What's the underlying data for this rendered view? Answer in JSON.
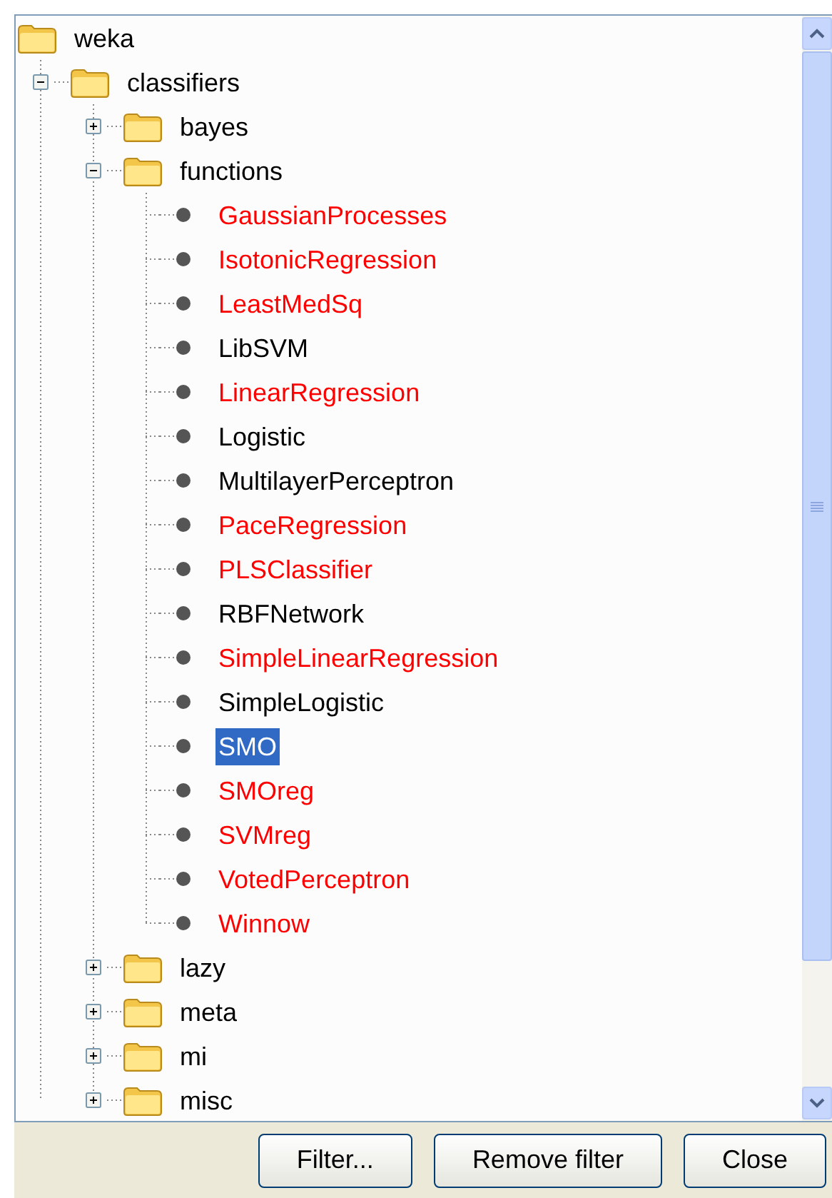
{
  "tree": {
    "label": "weka",
    "children": [
      {
        "kind": "folder",
        "label": "classifiers",
        "expanded": true,
        "children": [
          {
            "kind": "folder",
            "label": "bayes",
            "expanded": false
          },
          {
            "kind": "folder",
            "label": "functions",
            "expanded": true,
            "children": [
              {
                "kind": "leaf",
                "label": "GaussianProcesses",
                "color": "#ff0000",
                "selected": false
              },
              {
                "kind": "leaf",
                "label": "IsotonicRegression",
                "color": "#ff0000",
                "selected": false
              },
              {
                "kind": "leaf",
                "label": "LeastMedSq",
                "color": "#ff0000",
                "selected": false
              },
              {
                "kind": "leaf",
                "label": "LibSVM",
                "color": "#000000",
                "selected": false
              },
              {
                "kind": "leaf",
                "label": "LinearRegression",
                "color": "#ff0000",
                "selected": false
              },
              {
                "kind": "leaf",
                "label": "Logistic",
                "color": "#000000",
                "selected": false
              },
              {
                "kind": "leaf",
                "label": "MultilayerPerceptron",
                "color": "#000000",
                "selected": false
              },
              {
                "kind": "leaf",
                "label": "PaceRegression",
                "color": "#ff0000",
                "selected": false
              },
              {
                "kind": "leaf",
                "label": "PLSClassifier",
                "color": "#ff0000",
                "selected": false
              },
              {
                "kind": "leaf",
                "label": "RBFNetwork",
                "color": "#000000",
                "selected": false
              },
              {
                "kind": "leaf",
                "label": "SimpleLinearRegression",
                "color": "#ff0000",
                "selected": false
              },
              {
                "kind": "leaf",
                "label": "SimpleLogistic",
                "color": "#000000",
                "selected": false
              },
              {
                "kind": "leaf",
                "label": "SMO",
                "selected": true
              },
              {
                "kind": "leaf",
                "label": "SMOreg",
                "color": "#ff0000",
                "selected": false
              },
              {
                "kind": "leaf",
                "label": "SVMreg",
                "color": "#ff0000",
                "selected": false
              },
              {
                "kind": "leaf",
                "label": "VotedPerceptron",
                "color": "#ff0000",
                "selected": false
              },
              {
                "kind": "leaf",
                "label": "Winnow",
                "color": "#ff0000",
                "selected": false
              }
            ]
          },
          {
            "kind": "folder",
            "label": "lazy",
            "expanded": false
          },
          {
            "kind": "folder",
            "label": "meta",
            "expanded": false
          },
          {
            "kind": "folder",
            "label": "mi",
            "expanded": false
          },
          {
            "kind": "folder",
            "label": "misc",
            "expanded": false
          }
        ]
      }
    ]
  },
  "buttons": [
    "Filter...",
    "Remove filter",
    "Close"
  ]
}
